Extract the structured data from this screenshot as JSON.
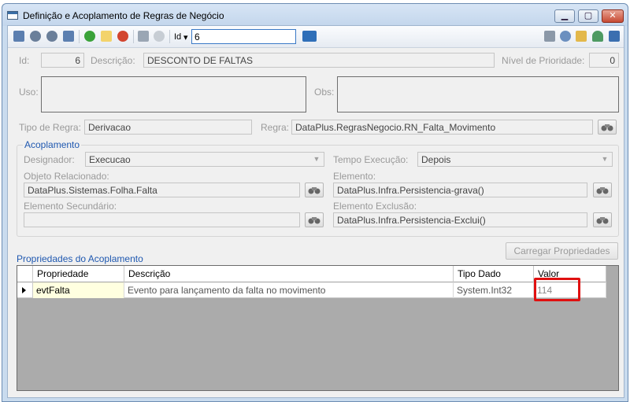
{
  "window": {
    "title": "Definição e Acoplamento de Regras de Negócio",
    "minimize": "▁",
    "maximize": "▢",
    "close": "✕"
  },
  "toolbar": {
    "id_label": "Id",
    "id_dropdown": "▾",
    "id_value": "6",
    "left_icons": [
      "first-record-icon",
      "previous-record-icon",
      "next-record-icon",
      "last-record-icon",
      "add-icon",
      "edit-icon",
      "delete-icon",
      "save-icon",
      "undo-icon",
      "search-go-icon"
    ],
    "right_icons": [
      "copy-icon",
      "tools-icon",
      "notes-icon",
      "user-icon",
      "exit-icon"
    ]
  },
  "header": {
    "id_label": "Id:",
    "id_value": "6",
    "descricao_label": "Descrição:",
    "descricao_value": "DESCONTO DE FALTAS",
    "prioridade_label": "Nível de Prioridade:",
    "prioridade_value": "0",
    "uso_label": "Uso:",
    "obs_label": "Obs:",
    "tipo_regra_label": "Tipo de Regra:",
    "tipo_regra_value": "Derivacao",
    "regra_label": "Regra:",
    "regra_value": "DataPlus.RegrasNegocio.RN_Falta_Movimento"
  },
  "acoplamento": {
    "title": "Acoplamento",
    "designador_label": "Designador:",
    "designador_value": "Execucao",
    "tempo_label": "Tempo Execução:",
    "tempo_value": "Depois",
    "objeto_label": "Objeto Relacionado:",
    "objeto_value": "DataPlus.Sistemas.Folha.Falta",
    "elemento_label": "Elemento:",
    "elemento_value": "DataPlus.Infra.Persistencia-grava()",
    "elemento_sec_label": "Elemento Secundário:",
    "elemento_sec_value": "",
    "elemento_exc_label": "Elemento Exclusão:",
    "elemento_exc_value": "DataPlus.Infra.Persistencia-Exclui()"
  },
  "carregar_button": "Carregar Propriedades",
  "propriedades": {
    "title": "Propriedades do Acoplamento",
    "columns": [
      "Propriedade",
      "Descrição",
      "Tipo Dado",
      "Valor"
    ],
    "rows": [
      [
        "evtFalta",
        "Evento para lançamento da falta no movimento",
        "System.Int32",
        "114"
      ]
    ]
  },
  "colors": {
    "accent_blue": "#1f58b0",
    "highlight_red": "#e01010",
    "window_frame": "#c9dbee"
  }
}
